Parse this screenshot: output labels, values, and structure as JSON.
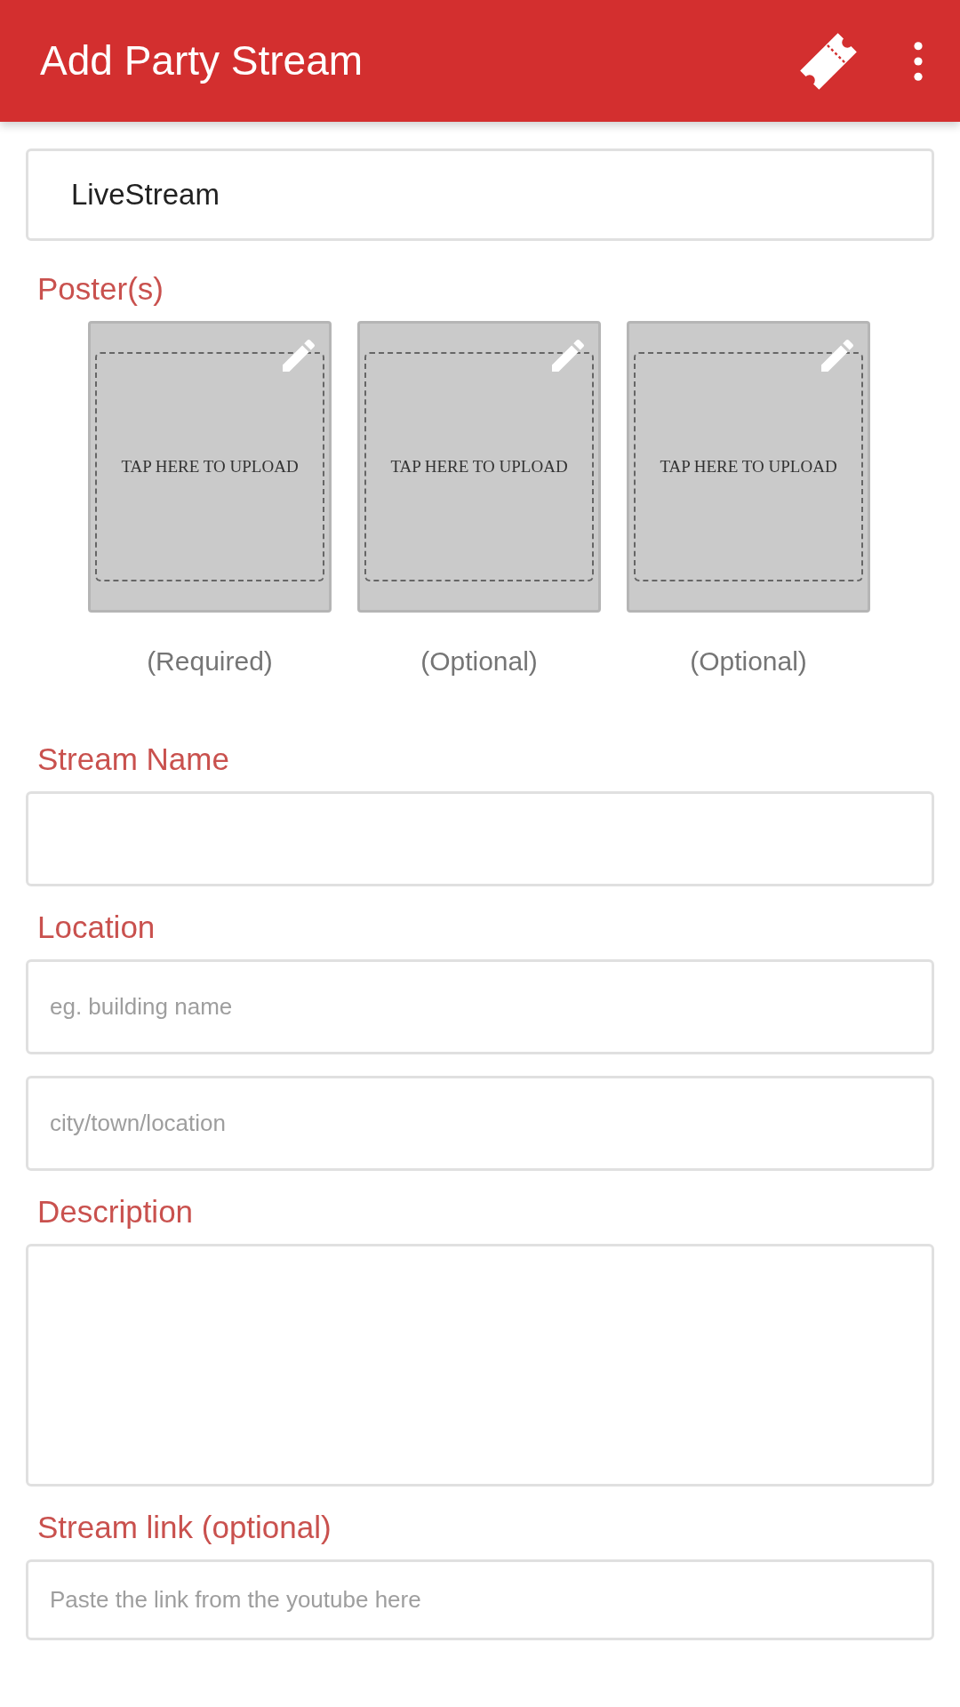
{
  "app_bar": {
    "title": "Add Party Stream"
  },
  "top_field": {
    "value": "LiveStream"
  },
  "posters": {
    "label": "Poster(s)",
    "tiles": [
      {
        "text": "TAP HERE TO UPLOAD",
        "caption": "(Required)"
      },
      {
        "text": "TAP HERE TO UPLOAD",
        "caption": "(Optional)"
      },
      {
        "text": "TAP HERE TO UPLOAD",
        "caption": "(Optional)"
      }
    ]
  },
  "sections": [
    {
      "label": "Stream Name",
      "fields": [
        {
          "kind": "input"
        }
      ]
    },
    {
      "label": "Location",
      "fields": [
        {
          "kind": "input",
          "placeholder": "eg. building name"
        },
        {
          "kind": "input",
          "placeholder": "city/town/location"
        }
      ]
    },
    {
      "label": "Description",
      "fields": [
        {
          "kind": "textarea"
        }
      ]
    },
    {
      "label": "Stream link (optional)",
      "fields": [
        {
          "kind": "link",
          "placeholder": "Paste the link from the youtube here"
        }
      ]
    }
  ]
}
